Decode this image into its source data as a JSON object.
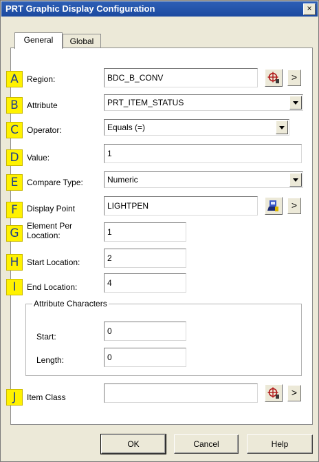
{
  "window": {
    "title": "PRT Graphic Display Configuration",
    "close_label": "×"
  },
  "tabs": [
    {
      "label": "General",
      "active": true
    },
    {
      "label": "Global",
      "active": false
    }
  ],
  "rows": {
    "region": {
      "badge": "A",
      "label": "Region:",
      "value": "BDC_B_CONV",
      "icon": "region-picker-icon",
      "next": ">"
    },
    "attribute": {
      "badge": "B",
      "label": "Attribute",
      "value": "PRT_ITEM_STATUS"
    },
    "operator": {
      "badge": "C",
      "label": "Operator:",
      "value": "Equals (=)"
    },
    "value": {
      "badge": "D",
      "label": "Value:",
      "value": "1"
    },
    "compare_type": {
      "badge": "E",
      "label": "Compare Type:",
      "value": "Numeric"
    },
    "display_point": {
      "badge": "F",
      "label": "Display Point",
      "value": "LIGHTPEN",
      "icon": "display-point-picker-icon",
      "next": ">"
    },
    "element_per_location": {
      "badge": "G",
      "label_line1": "Element Per",
      "label_line2": "Location:",
      "value": "1"
    },
    "start_location": {
      "badge": "H",
      "label": "Start Location:",
      "value": "2"
    },
    "end_location": {
      "badge": "I",
      "label": "End Location:",
      "value": "4"
    },
    "item_class": {
      "badge": "J",
      "label": "Item Class",
      "value": "",
      "icon": "item-class-picker-icon",
      "next": ">"
    }
  },
  "attribute_characters": {
    "group_label": "Attribute Characters",
    "start_label": "Start:",
    "start_value": "0",
    "length_label": "Length:",
    "length_value": "0"
  },
  "buttons": {
    "ok": "OK",
    "cancel": "Cancel",
    "help": "Help"
  },
  "colors": {
    "titlebar": "#1c4aa0",
    "badge": "#fff200",
    "badge_text": "#1e3f8a",
    "dialog": "#ece9d8"
  }
}
